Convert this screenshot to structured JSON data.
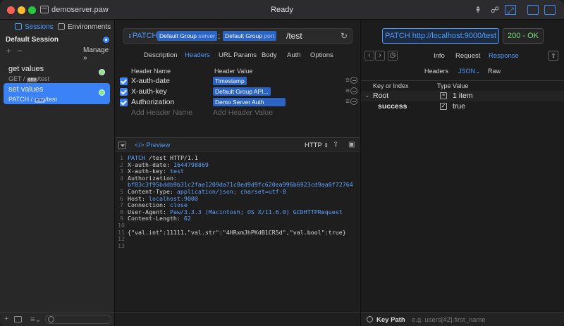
{
  "window": {
    "filename": "demoserver.paw",
    "status": "Ready"
  },
  "sidebar": {
    "tabs": [
      {
        "label": "Sessions",
        "active": true
      },
      {
        "label": "Environments",
        "active": false
      }
    ],
    "session_title": "Default Session",
    "manage_label": "Manage",
    "requests": [
      {
        "name": "get values",
        "method": "GET",
        "path": "/test",
        "selected": false
      },
      {
        "name": "set values",
        "method": "PATCH",
        "path": "/test",
        "selected": true
      }
    ],
    "env_chip": "env"
  },
  "request": {
    "method": "PATCH",
    "url_tokens": [
      {
        "label": "Default Group",
        "sub": "server"
      },
      {
        "label": "Default Group",
        "sub": "port"
      }
    ],
    "url_separator": ":",
    "path": "/test",
    "tabs": [
      {
        "label": "Description"
      },
      {
        "label": "Headers",
        "active": true
      },
      {
        "label": "URL Params"
      },
      {
        "label": "Body"
      },
      {
        "label": "Auth"
      },
      {
        "label": "Options"
      }
    ],
    "header_columns": {
      "name": "Header Name",
      "value": "Header Value"
    },
    "headers": [
      {
        "name": "X-auth-date",
        "value": "Timestamp",
        "token": true
      },
      {
        "name": "X-auth-key",
        "value": "Default Group API...",
        "token": true
      },
      {
        "name": "Authorization",
        "value": "Demo Server Auth",
        "token": true
      }
    ],
    "add_name_placeholder": "Add Header Name",
    "add_value_placeholder": "Add Header Value"
  },
  "preview": {
    "tab_label": "Preview",
    "format": "HTTP",
    "lines": [
      {
        "n": "1",
        "t": "PATCH /test HTTP/1.1"
      },
      {
        "n": "2",
        "t": "X-auth-date: 1644798869"
      },
      {
        "n": "3",
        "t": "X-auth-key: test"
      },
      {
        "n": "4",
        "t": "Authorization:"
      },
      {
        "n": "",
        "t": "bf83c3f95bddb9b31c2fae1209da71c8ed9d9fc620ea996b6923cd9aa0f72764"
      },
      {
        "n": "5",
        "t": "Content-Type: application/json; charset=utf-8"
      },
      {
        "n": "6",
        "t": "Host: localhost:9000"
      },
      {
        "n": "7",
        "t": "Connection: close"
      },
      {
        "n": "8",
        "t": "User-Agent: Paw/3.3.3 (Macintosh; OS X/11.6.0) GCDHTTPRequest"
      },
      {
        "n": "9",
        "t": "Content-Length: 62"
      },
      {
        "n": "10",
        "t": ""
      },
      {
        "n": "11",
        "t": "{\"val.int\":11111,\"val.str\":\"4HRxmJhPKdB1CR5d\",\"val.bool\":true}"
      },
      {
        "n": "12",
        "t": ""
      },
      {
        "n": "13",
        "t": ""
      }
    ]
  },
  "response": {
    "summary": "PATCH http://localhost:9000/test",
    "status": "200 - OK",
    "tabs": [
      {
        "label": "Info"
      },
      {
        "label": "Request"
      },
      {
        "label": "Response",
        "active": true
      }
    ],
    "subtabs": [
      {
        "label": "Headers"
      },
      {
        "label": "JSON",
        "active": true
      },
      {
        "label": "Raw"
      }
    ],
    "columns": {
      "key": "Key or Index",
      "type": "Type",
      "value": "Value"
    },
    "rows": [
      {
        "key": "Root",
        "type": "object",
        "value": "1 item"
      },
      {
        "key": "success",
        "type": "bool",
        "value": "true"
      }
    ],
    "keypath_label": "Key Path",
    "keypath_placeholder": "e.g. users[42].first_name"
  }
}
